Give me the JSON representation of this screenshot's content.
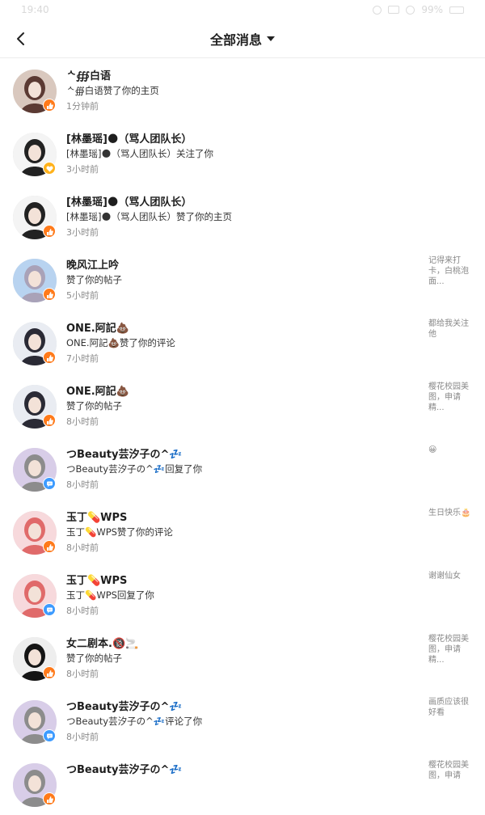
{
  "status": {
    "time": "19:40",
    "battery": "99%"
  },
  "header": {
    "title": "全部消息"
  },
  "messages": [
    {
      "name": "ᄾ∰白语",
      "action": "ᄾ∰白语赞了你的主页",
      "time": "1分钟前",
      "preview": "",
      "badge": "like",
      "avatar_colors": [
        "#d9c8be",
        "#5b3a33"
      ]
    },
    {
      "name": "[林墨瑶]🌑（骂人团队长）",
      "action": "[林墨瑶]🌑（骂人团队长）关注了你",
      "time": "3小时前",
      "preview": "",
      "badge": "follow",
      "avatar_colors": [
        "#f4f4f4",
        "#222222"
      ]
    },
    {
      "name": "[林墨瑶]🌑（骂人团队长）",
      "action": "[林墨瑶]🌑（骂人团队长）赞了你的主页",
      "time": "3小时前",
      "preview": "",
      "badge": "like",
      "avatar_colors": [
        "#f4f4f4",
        "#222222"
      ]
    },
    {
      "name": "晚风江上吟",
      "action": "赞了你的帖子",
      "time": "5小时前",
      "preview": "记得来打卡，白桃泡面...",
      "badge": "like",
      "avatar_colors": [
        "#b8d3f0",
        "#a9a2b8"
      ]
    },
    {
      "name": "ONE.阿記💩",
      "action": "ONE.阿記💩赞了你的评论",
      "time": "7小时前",
      "preview": "都给我关注他",
      "badge": "like",
      "avatar_colors": [
        "#e9ecf2",
        "#2a2a35"
      ]
    },
    {
      "name": "ONE.阿記💩",
      "action": "赞了你的帖子",
      "time": "8小时前",
      "preview": "樱花校园美图，申请精...",
      "badge": "like",
      "avatar_colors": [
        "#e9ecf2",
        "#2a2a35"
      ]
    },
    {
      "name": "つBeauty芸汐子の^💤",
      "action": "つBeauty芸汐子の^💤回复了你",
      "time": "8小时前",
      "preview": "😀",
      "badge": "reply",
      "avatar_colors": [
        "#d8cde8",
        "#8c8c8c"
      ]
    },
    {
      "name": "玉丁💊WPS",
      "action": "玉丁💊WPS赞了你的评论",
      "time": "8小时前",
      "preview": "生日快乐🎂",
      "badge": "like",
      "avatar_colors": [
        "#f7d9dc",
        "#e06a6a"
      ]
    },
    {
      "name": "玉丁💊WPS",
      "action": "玉丁💊WPS回复了你",
      "time": "8小时前",
      "preview": "谢谢仙女",
      "badge": "reply",
      "avatar_colors": [
        "#f7d9dc",
        "#e06a6a"
      ]
    },
    {
      "name": "女二剧本.🔞🚬",
      "action": "赞了你的帖子",
      "time": "8小时前",
      "preview": "樱花校园美图，申请精...",
      "badge": "like",
      "avatar_colors": [
        "#eeeeee",
        "#151515"
      ]
    },
    {
      "name": "つBeauty芸汐子の^💤",
      "action": "つBeauty芸汐子の^💤评论了你",
      "time": "8小时前",
      "preview": "画质应该很好看",
      "badge": "reply",
      "avatar_colors": [
        "#d8cde8",
        "#8c8c8c"
      ]
    },
    {
      "name": "つBeauty芸汐子の^💤",
      "action": "",
      "time": "",
      "preview": "樱花校园美图，申请",
      "badge": "like",
      "avatar_colors": [
        "#d8cde8",
        "#8c8c8c"
      ]
    }
  ]
}
